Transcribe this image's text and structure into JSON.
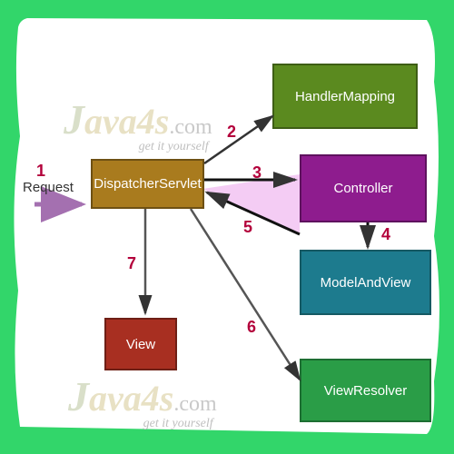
{
  "watermark": {
    "brand_j": "J",
    "brand_rest": "ava4s",
    "brand_tld": ".com",
    "tagline": "get it yourself"
  },
  "request_label": "Request",
  "boxes": {
    "dispatcher": "DispatcherServlet",
    "handler": "HandlerMapping",
    "controller": "Controller",
    "modelview": "ModelAndView",
    "viewresolver": "ViewResolver",
    "view": "View"
  },
  "steps": {
    "s1": "1",
    "s2": "2",
    "s3": "3",
    "s4": "4",
    "s5": "5",
    "s6": "6",
    "s7": "7"
  },
  "colors": {
    "frame": "#32d66a",
    "accent": "#b3003b"
  }
}
